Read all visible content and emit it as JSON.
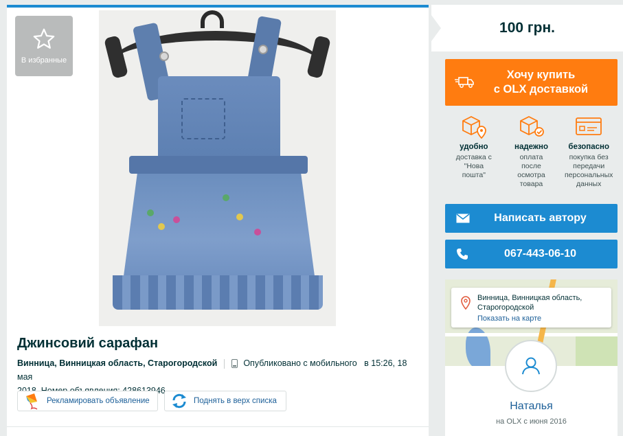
{
  "listing": {
    "favorite_label": "В избранные",
    "title": "Джинсовий сарафан",
    "location": "Винница, Винницкая область, Старогородской",
    "published": "Опубликовано с мобильного",
    "time_prefix": "в 15:26, 18 мая",
    "date_and_id": "2018, Номер объявления: 428613946",
    "promote_label": "Рекламировать объявление",
    "bump_label": "Поднять в верх списка"
  },
  "sidebar": {
    "price": "100 грн.",
    "buy_line1": "Хочу купить",
    "buy_line2": "с OLX доставкой",
    "benefits": [
      {
        "title": "удобно",
        "desc": "доставка с \"Нова пошта\"",
        "icon": "box-location-icon"
      },
      {
        "title": "надежно",
        "desc": "оплата после осмотра товара",
        "icon": "box-check-icon"
      },
      {
        "title": "безопасно",
        "desc": "покупка без передачи персональных данных",
        "icon": "card-icon"
      }
    ],
    "message_label": "Написать автору",
    "phone": "067-443-06-10",
    "location": "Винница, Винницкая область, Старогородской",
    "show_map": "Показать на карте",
    "user_name": "Наталья",
    "member_since": "на OLX с июня 2016"
  },
  "colors": {
    "brand_blue": "#1c8bd1",
    "orange": "#ff7c10",
    "dark_text": "#002f34",
    "page_bg": "#e9ecec"
  }
}
